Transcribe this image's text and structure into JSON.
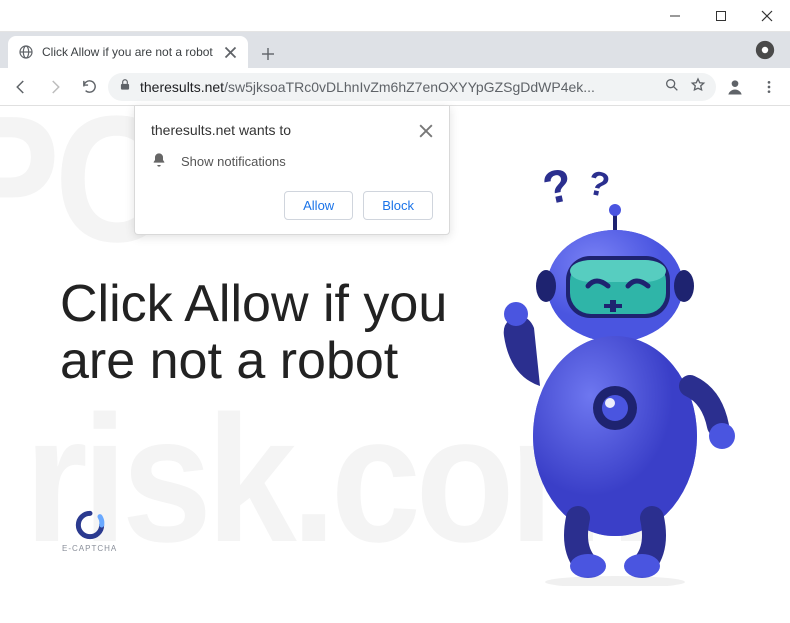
{
  "window": {
    "minimize": "–",
    "maximize": "☐",
    "close": "×"
  },
  "tabs": [
    {
      "title": "Click Allow if you are not a robot"
    }
  ],
  "address": {
    "host": "theresults.net",
    "path": "/sw5jksoaTRc0vDLhnIvZm6hZ7enOXYYpGZSgDdWP4ek..."
  },
  "permission": {
    "origin": "theresults.net wants to",
    "request": "Show notifications",
    "allow": "Allow",
    "block": "Block"
  },
  "page": {
    "headline": "Click Allow if you are not a robot",
    "captcha_label": "E-CAPTCHA",
    "watermark1": "PC",
    "watermark2": "risk.com"
  },
  "colors": {
    "primary_blue": "#3a3fc8",
    "accent": "#1a73e8"
  }
}
